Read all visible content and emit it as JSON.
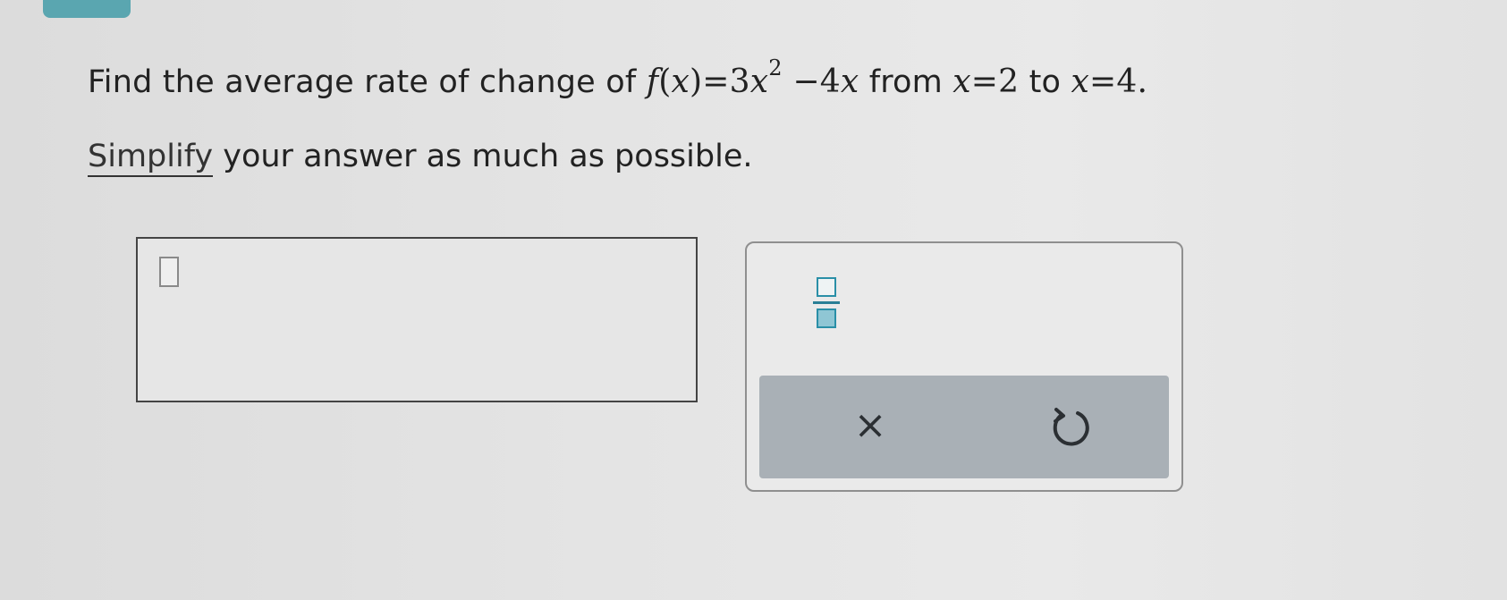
{
  "question": {
    "prefix": "Find the average rate of change of ",
    "function_f": "f",
    "function_open": "(",
    "function_var": "x",
    "function_close": ")",
    "equals": "=",
    "coef_a": "3",
    "var_x1": "x",
    "exponent": "2",
    "minus": "−",
    "coef_b": "4",
    "var_x2": "x",
    "from_text": " from ",
    "from_var": "x",
    "from_equals": "=",
    "from_value": "2",
    "to_text": " to ",
    "to_var": "x",
    "to_equals": "=",
    "to_value": "4",
    "period": "."
  },
  "instruction": {
    "link_text": "Simplify",
    "rest_text": " your answer as much as possible."
  },
  "answer": {
    "value": ""
  },
  "keypad": {
    "clear_symbol": "×",
    "fraction_icon": "fraction-icon",
    "undo_icon": "undo-icon"
  },
  "colors": {
    "accent": "#2a8fa7",
    "tab": "#5aa6b0",
    "keypad_bar": "#a9b0b6"
  }
}
